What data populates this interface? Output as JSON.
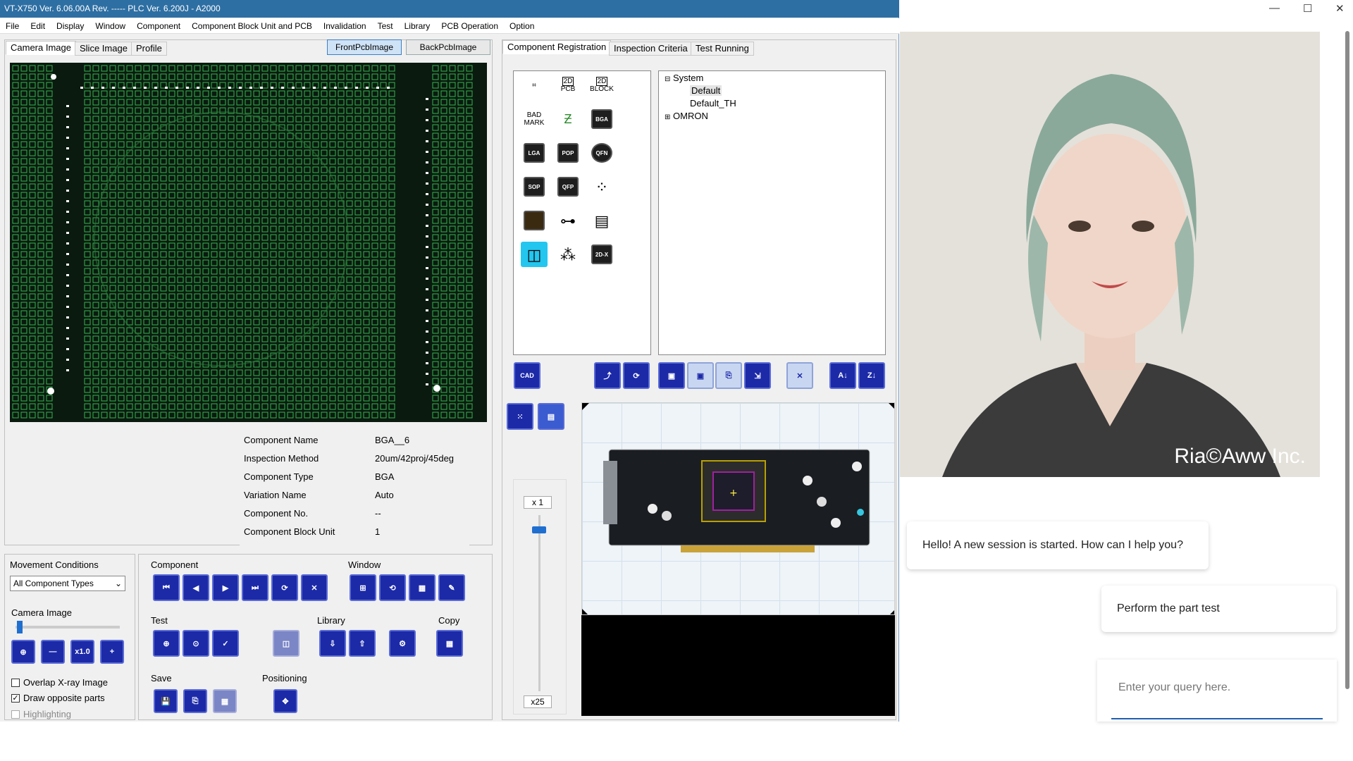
{
  "window": {
    "title": "VT-X750 Ver. 6.06.00A Rev. ----- PLC Ver.  6.200J  - A2000"
  },
  "menu": [
    "File",
    "Edit",
    "Display",
    "Window",
    "Component",
    "Component Block Unit and PCB",
    "Invalidation",
    "Test",
    "Library",
    "PCB Operation",
    "Option"
  ],
  "left_tabs": [
    "Camera Image",
    "Slice Image",
    "Profile"
  ],
  "pcb_buttons": {
    "front": "FrontPcbImage",
    "back": "BackPcbImage"
  },
  "right_tabs": [
    "Component Registration",
    "Inspection Criteria",
    "Test Running"
  ],
  "component_info": {
    "rows": [
      {
        "label": "Component Name",
        "value": "BGA__6"
      },
      {
        "label": "Inspection Method",
        "value": "20um/42proj/45deg"
      },
      {
        "label": "Component Type",
        "value": "BGA"
      },
      {
        "label": "Variation Name",
        "value": "Auto"
      },
      {
        "label": "Component No.",
        "value": "--"
      },
      {
        "label": "Component Block Unit",
        "value": "1"
      }
    ]
  },
  "movement": {
    "label": "Movement Conditions",
    "select_value": "All Component Types"
  },
  "camera_image": {
    "label": "Camera Image",
    "zoom_label": "x1.0"
  },
  "checkboxes": [
    {
      "label": "Overlap X-ray Image",
      "checked": false
    },
    {
      "label": "Draw opposite parts",
      "checked": true
    },
    {
      "label": "Highlighting",
      "checked": false
    }
  ],
  "groups": {
    "component": "Component",
    "window": "Window",
    "test": "Test",
    "library": "Library",
    "copy": "Copy",
    "save": "Save",
    "positioning": "Positioning"
  },
  "palette": {
    "pcb": "PCB",
    "block": "BLOCK",
    "twod": "2D",
    "bad": "BAD",
    "mark": "MARK",
    "bga": "BGA",
    "lga": "LGA",
    "pop": "POP",
    "qfn": "QFN",
    "sop": "SOP",
    "qfp": "QFP",
    "twodx": "2D-X",
    "cad": "CAD"
  },
  "tree": {
    "system": "System",
    "default": "Default",
    "default_th": "Default_TH",
    "omron": "OMRON"
  },
  "zoom": {
    "top": "x 1",
    "bottom": "x25",
    "level": 0.06
  },
  "chat": {
    "brand": "Ria©Aww Inc.",
    "bot_message": "Hello! A new session is started. How can I help you?",
    "user_message": "Perform the part test",
    "input_placeholder": "Enter your query here."
  },
  "colors": {
    "title_bar": "#2e6fa3",
    "icon_button": "#1c2aa8",
    "pcb_grid": "#3fd05a"
  }
}
